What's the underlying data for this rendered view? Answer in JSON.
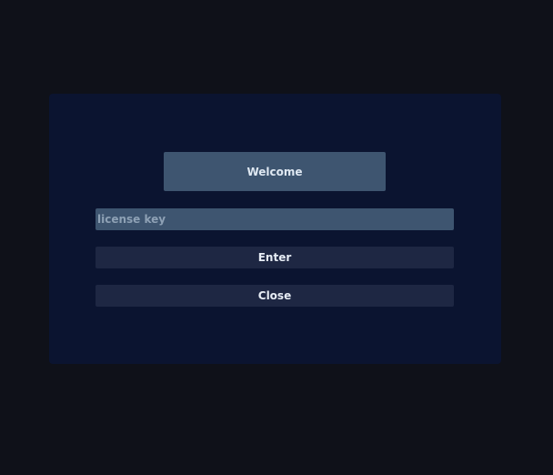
{
  "dialog": {
    "title": "Welcome",
    "license_input": {
      "value": "",
      "placeholder": "license key"
    },
    "enter_label": "Enter",
    "close_label": "Close"
  }
}
